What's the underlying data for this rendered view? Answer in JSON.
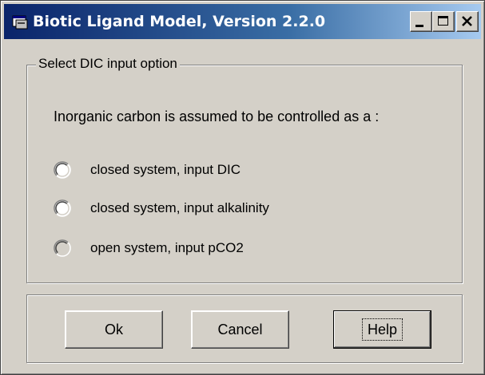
{
  "window": {
    "title": "Biotic Ligand Model, Version 2.2.0",
    "controls": [
      "minimize",
      "maximize",
      "close"
    ]
  },
  "group": {
    "title": "Select DIC input option",
    "lead": "Inorganic carbon is assumed to be controlled as a :",
    "options": [
      {
        "label": "closed system, input DIC",
        "selected": false
      },
      {
        "label": "closed system, input alkalinity",
        "selected": false
      },
      {
        "label": "open system, input pCO2",
        "selected": false,
        "disabled": true
      }
    ]
  },
  "buttons": {
    "ok": "Ok",
    "cancel": "Cancel",
    "help": "Help"
  },
  "colors": {
    "title_bar_start": "#0a246a",
    "title_bar_end": "#a6caf0",
    "face": "#d4d0c8"
  }
}
